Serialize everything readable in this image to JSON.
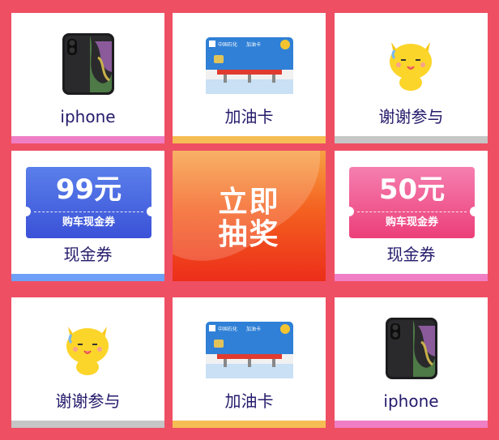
{
  "grid": {
    "items": [
      {
        "label": "iphone",
        "icon": "iphone-icon",
        "bar_color": "#f07ec5"
      },
      {
        "label": "加油卡",
        "icon": "fuel-card-icon",
        "bar_color": "#f6bd55"
      },
      {
        "label": "谢谢参与",
        "icon": "cat-mascot-icon",
        "bar_color": "#c6c6c6"
      },
      {
        "label": "现金券",
        "icon": "coupon-icon",
        "bar_color": "#6ea0f7",
        "coupon_amount": "99元",
        "coupon_desc": "购车现金券"
      },
      {
        "label": "现金券",
        "icon": "coupon-icon",
        "bar_color": "#f07ec5",
        "coupon_amount": "50元",
        "coupon_desc": "购车现金券"
      },
      {
        "label": "谢谢参与",
        "icon": "cat-mascot-icon",
        "bar_color": "#c6c6c6"
      },
      {
        "label": "加油卡",
        "icon": "fuel-card-icon",
        "bar_color": "#f6bd55"
      },
      {
        "label": "iphone",
        "icon": "iphone-icon",
        "bar_color": "#f07ec5"
      }
    ],
    "draw_button": {
      "line1": "立即",
      "line2": "抽奖"
    }
  },
  "colors": {
    "background": "#ef4f63",
    "label_text": "#241a6b",
    "coupon_blue": "#4a67e0",
    "coupon_pink": "#f04f86"
  },
  "fuel_card": {
    "brand": "中国石化",
    "title": "加油卡"
  }
}
